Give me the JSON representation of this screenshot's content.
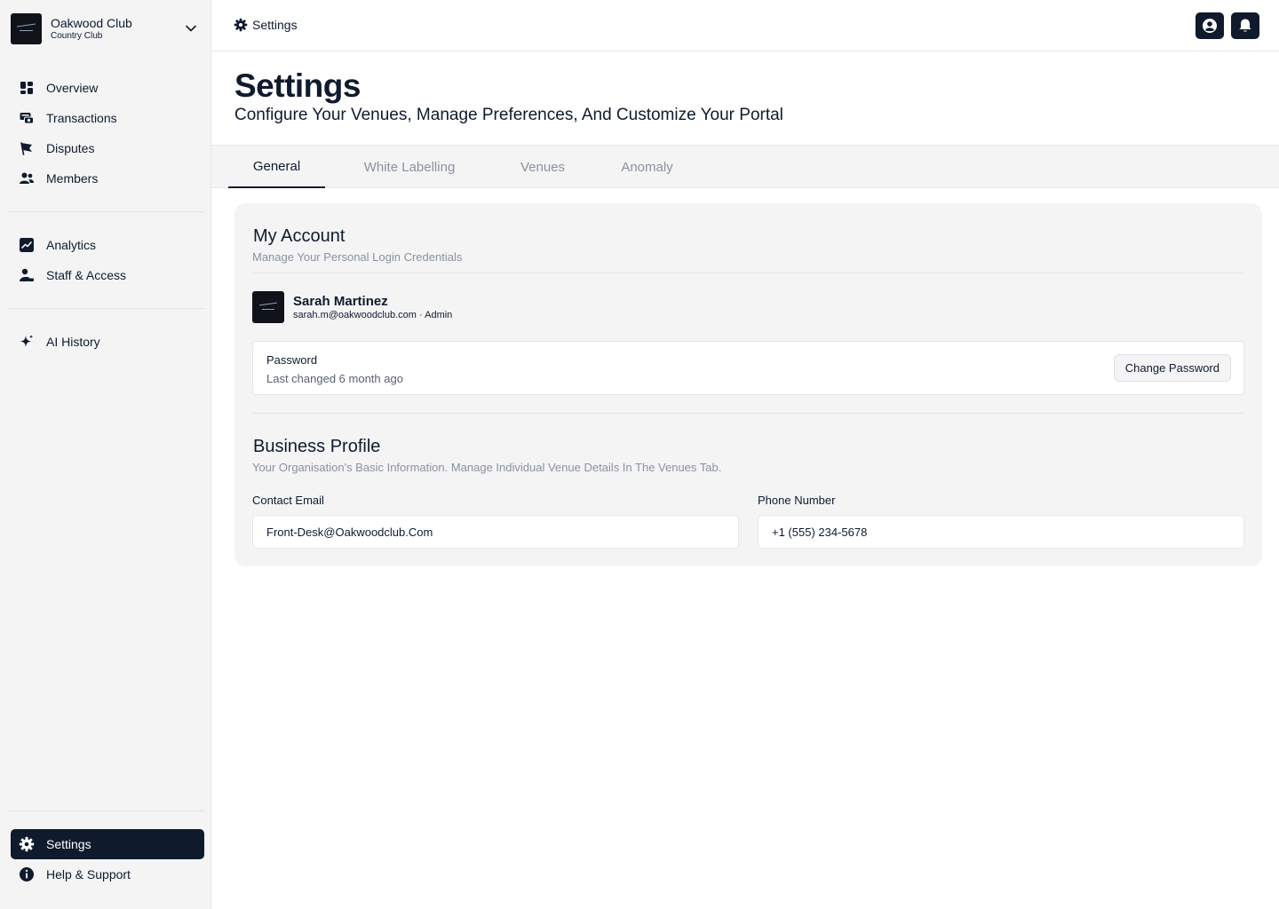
{
  "sidebar": {
    "club": {
      "name": "Oakwood Club",
      "type": "Country Club"
    },
    "nav_main": [
      {
        "label": "Overview",
        "icon": "overview-icon"
      },
      {
        "label": "Transactions",
        "icon": "transactions-icon"
      },
      {
        "label": "Disputes",
        "icon": "flag-icon"
      },
      {
        "label": "Members",
        "icon": "members-icon"
      }
    ],
    "nav_secondary": [
      {
        "label": "Analytics",
        "icon": "chart-icon"
      },
      {
        "label": "Staff & Access",
        "icon": "staff-icon"
      }
    ],
    "nav_ai": [
      {
        "label": "AI History",
        "icon": "sparkle-icon"
      }
    ],
    "nav_bottom": [
      {
        "label": "Settings",
        "icon": "gear-icon",
        "active": true
      },
      {
        "label": "Help & Support",
        "icon": "info-icon"
      }
    ]
  },
  "topbar": {
    "breadcrumb": "Settings"
  },
  "header": {
    "title": "Settings",
    "subtitle": "Configure Your Venues, Manage Preferences, And Customize Your Portal"
  },
  "tabs": [
    {
      "label": "General",
      "active": true
    },
    {
      "label": "White Labelling"
    },
    {
      "label": "Venues"
    },
    {
      "label": "Anomaly"
    }
  ],
  "account": {
    "title": "My Account",
    "subtitle": "Manage Your Personal Login Credentials",
    "user": {
      "name": "Sarah Martinez",
      "meta": "sarah.m@oakwoodclub.com · Admin"
    },
    "password": {
      "label": "Password",
      "last_changed": "Last changed 6 month ago",
      "button": "Change Password"
    }
  },
  "business": {
    "title": "Business Profile",
    "subtitle": "Your Organisation's Basic Information. Manage Individual Venue Details In The Venues Tab.",
    "contact_email": {
      "label": "Contact Email",
      "value": "Front-Desk@Oakwoodclub.Com"
    },
    "phone": {
      "label": "Phone Number",
      "value": "+1 (555) 234-5678"
    }
  },
  "colors": {
    "brand_dark": "#0f1b2d",
    "sidebar_bg": "#f4f4f5",
    "muted_text": "#8a929e"
  }
}
